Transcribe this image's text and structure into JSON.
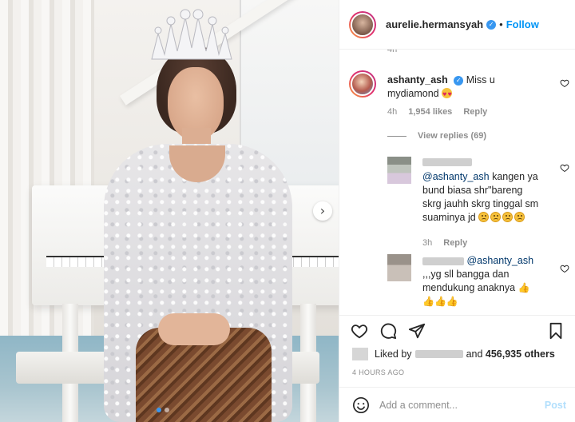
{
  "header": {
    "username": "aurelie.hermansyah",
    "verified_icon": "verified-badge-icon",
    "separator": "•",
    "follow_label": "Follow"
  },
  "comments": {
    "ghost_time": "4h",
    "main": {
      "username": "ashanty_ash",
      "text": "Miss u mydiamond",
      "emoji": "heart-eyes-emoji",
      "time": "4h",
      "likes": "1,954 likes",
      "reply_label": "Reply"
    },
    "view_replies": "View replies (69)",
    "replies": [
      {
        "mention": "@ashanty_ash",
        "text": "kangen ya bund biasa shr\"bareng skrg jauhh skrg tinggal sm suaminya jd",
        "time": "3h",
        "reply_label": "Reply"
      },
      {
        "mention": "@ashanty_ash",
        "text": ",,,yg sll bangga dan mendukung anaknya"
      }
    ]
  },
  "actions": {
    "liked_prefix": "Liked by",
    "liked_and": "and",
    "others": "456,935 others",
    "post_time": "4 HOURS AGO"
  },
  "composer": {
    "placeholder": "Add a comment...",
    "post_label": "Post"
  },
  "carousel": {
    "next_arrow": "›",
    "pages": 2,
    "active_page": 1
  },
  "colors": {
    "accent": "#0095f6",
    "verified": "#3897f0",
    "muted": "#8e8e8e",
    "mention": "#00376b",
    "post_disabled": "#b2dffc"
  }
}
